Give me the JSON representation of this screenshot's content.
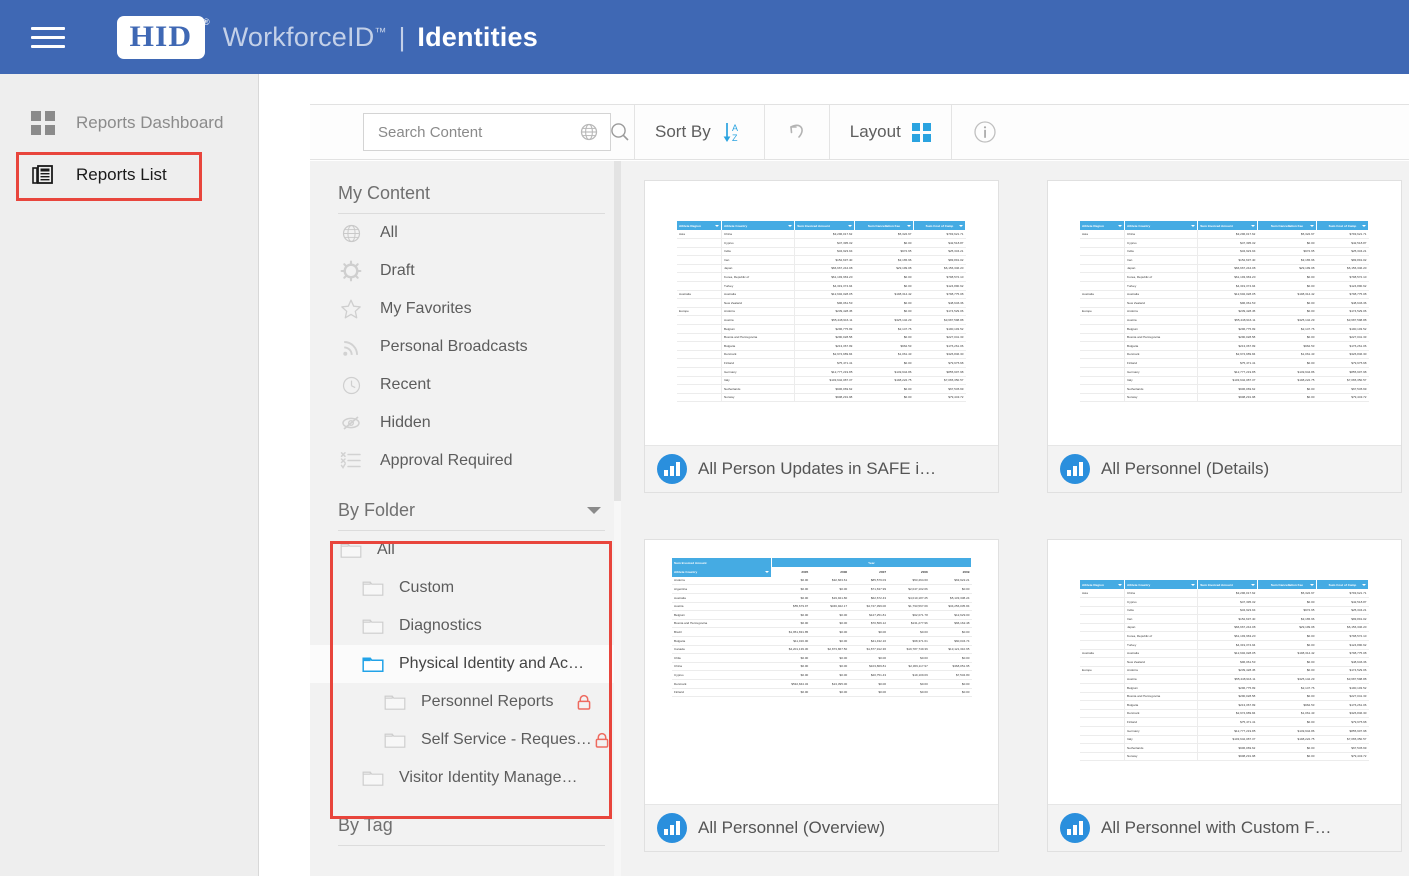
{
  "header": {
    "menu_icon": "hamburger-icon",
    "logo_text": "HID",
    "logo_registered": "®",
    "product_name": "WorkforceID",
    "trademark": "™",
    "separator": "|",
    "section": "Identities",
    "bg_color": "#3f68b4"
  },
  "left_nav": {
    "items": [
      {
        "label": "Reports Dashboard",
        "icon": "dashboard-icon",
        "selected": false
      },
      {
        "label": "Reports List",
        "icon": "reports-list-icon",
        "selected": true
      }
    ]
  },
  "toolbar": {
    "search": {
      "placeholder": "Search Content",
      "value": ""
    },
    "globe_icon": "globe-icon",
    "search_icon": "magnifier-icon",
    "sort_by_label": "Sort By",
    "sort_icon": "sort-az-icon",
    "undo_icon": "undo-icon",
    "layout_label": "Layout",
    "layout_icon": "grid-icon",
    "info_icon": "info-icon",
    "accent_color": "#2aa3e0"
  },
  "filter_panel": {
    "my_content": {
      "title": "My Content",
      "items": [
        {
          "label": "All",
          "icon": "globe-icon"
        },
        {
          "label": "Draft",
          "icon": "gear-icon"
        },
        {
          "label": "My Favorites",
          "icon": "star-icon"
        },
        {
          "label": "Personal Broadcasts",
          "icon": "rss-icon"
        },
        {
          "label": "Recent",
          "icon": "clock-icon"
        },
        {
          "label": "Hidden",
          "icon": "eye-slash-icon"
        },
        {
          "label": "Approval Required",
          "icon": "checklist-icon"
        }
      ]
    },
    "by_folder": {
      "title": "By Folder",
      "collapse_icon": "caret-down-icon",
      "items": [
        {
          "label": "All",
          "indent": 0,
          "selected": false,
          "locked": false
        },
        {
          "label": "Custom",
          "indent": 1,
          "selected": false,
          "locked": false
        },
        {
          "label": "Diagnostics",
          "indent": 1,
          "selected": false,
          "locked": false
        },
        {
          "label": "Physical Identity and Ac…",
          "indent": 1,
          "selected": true,
          "locked": false
        },
        {
          "label": "Personnel Reports",
          "indent": 2,
          "selected": false,
          "locked": true
        },
        {
          "label": "Self Service - Reques…",
          "indent": 2,
          "selected": false,
          "locked": true
        },
        {
          "label": "Visitor Identity Manage…",
          "indent": 1,
          "selected": false,
          "locked": false
        }
      ]
    },
    "by_tag": {
      "title": "By Tag"
    }
  },
  "cards": [
    {
      "title": "All Person Updates in SAFE i…",
      "icon": "bar-chart-icon",
      "thumb": "detail"
    },
    {
      "title": "All Personnel (Details)",
      "icon": "bar-chart-icon",
      "thumb": "detail"
    },
    {
      "title": "All Personnel (Overview)",
      "icon": "bar-chart-icon",
      "thumb": "pivot"
    },
    {
      "title": "All Personnel with Custom F…",
      "icon": "bar-chart-icon",
      "thumb": "detail"
    }
  ],
  "thumbnail_detail": {
    "columns": [
      "Athlete Region",
      "Athlete Country",
      "Sum Invoiced Amount",
      "Sum Cancellation Fee",
      "Sum Cost of Camp"
    ],
    "rows": [
      [
        "Asia",
        "China",
        "$3,296,017.62",
        "$5,322.67",
        "$793,621.71"
      ],
      [
        "",
        "Cyprus",
        "$47,395.32",
        "$0.00",
        "$42,518.87"
      ],
      [
        "",
        "India",
        "$34,923.94",
        "$972.65",
        "$25,334.21"
      ],
      [
        "",
        "Iran",
        "$152,697.40",
        "$3,165.96",
        "$83,891.02"
      ],
      [
        "",
        "Japan",
        "$66,667,244.08",
        "$29,199.08",
        "$6,156,346.20"
      ],
      [
        "",
        "Korea, Republic of",
        "$61,193,963.20",
        "$0.00",
        "$798,572.10"
      ],
      [
        "",
        "Turkey",
        "$4,319,374.94",
        "$0.00",
        "$124,890.62"
      ],
      [
        "Australia",
        "Australia",
        "$12,602,028.05",
        "$198,314.42",
        "$798,775.08"
      ],
      [
        "",
        "New Zealand",
        "$96,061.53",
        "$0.00",
        "$48,646.36"
      ],
      [
        "Europe",
        "Andorra",
        "$239,428.45",
        "$0.00",
        "$174,529.06"
      ],
      [
        "",
        "Austria",
        "$55,448,916.11",
        "$325,142.29",
        "$3,687,598.88"
      ],
      [
        "",
        "Belgium",
        "$296,775.99",
        "$2,147.76",
        "$190,103.52"
      ],
      [
        "",
        "Bosnia and Herzegovina",
        "$290,028.58",
        "$0.00",
        "$227,041.33"
      ],
      [
        "",
        "Bulgaria",
        "$213,367.99",
        "$962.53",
        "$176,261.06"
      ],
      [
        "",
        "Denmark",
        "$2,974,989.84",
        "$1,061.43",
        "$326,846.30"
      ],
      [
        "",
        "Finland",
        "$75,471.41",
        "$0.00",
        "$79,975.68"
      ],
      [
        "",
        "Germany",
        "$12,777,219.85",
        "$149,944.86",
        "$855,907.98"
      ],
      [
        "",
        "Italy",
        "$103,642,087.37",
        "$198,222.75",
        "$7,065,350.57"
      ],
      [
        "",
        "Netherlands",
        "$906,069.62",
        "$0.00",
        "$67,545.69"
      ],
      [
        "",
        "Norway",
        "$908,291.98",
        "$0.00",
        "$79,443.72"
      ]
    ]
  },
  "thumbnail_pivot": {
    "measure_label": "Sum Invoiced Amount",
    "row_label": "Athlete Country",
    "column_group": "Year",
    "years": [
      "2005",
      "2006",
      "2007",
      "2008",
      "2009"
    ],
    "rows": [
      [
        "Andorra",
        "$0.00",
        "$32,663.61",
        "$85,579.03",
        "$53,264.60",
        "$63,922.21"
      ],
      [
        "Argentina",
        "$0.00",
        "$0.00",
        "$71,637.99",
        "$2,047,102.06",
        "$0.00"
      ],
      [
        "Australia",
        "$0.00",
        "$19,921.80",
        "$62,672.43",
        "$4,010,187.25",
        "$5,133,338.24"
      ],
      [
        "Austria",
        "$55,679.97",
        "$346,922.17",
        "$4,727,399.00",
        "$1,793,567.09",
        "$34,256,035.84"
      ],
      [
        "Belgium",
        "$0.00",
        "$0.00",
        "$127,251.81",
        "$62,071.78",
        "$12,629.00"
      ],
      [
        "Bosnia and Herzegovina",
        "$0.00",
        "$0.00",
        "$70,566.12",
        "$131,277.96",
        "$66,162.48"
      ],
      [
        "Brazil",
        "$1,951,831.85",
        "$0.00",
        "$0.00",
        "$0.00",
        "$0.00"
      ],
      [
        "Bulgaria",
        "$11,016.00",
        "$0.00",
        "$41,432.16",
        "$68,371.61",
        "$60,034.74"
      ],
      [
        "Canada",
        "$4,201,139.30",
        "$2,873,867.50",
        "$1,877,912.36",
        "$19,787,749.36",
        "$13,121,310.65"
      ],
      [
        "Chile",
        "$0.00",
        "$0.00",
        "$0.00",
        "$0.00",
        "$0.00"
      ],
      [
        "China",
        "$0.00",
        "$0.00",
        "$103,869.81",
        "$2,369,117.97",
        "$368,051.95"
      ],
      [
        "Cyprus",
        "$0.00",
        "$0.00",
        "$20,751.43",
        "$19,109.09",
        "$7,534.80"
      ],
      [
        "Denmark",
        "$532,844.32",
        "$13,395.00",
        "$0.00",
        "$0.00",
        "$0.00"
      ],
      [
        "Finland",
        "$0.00",
        "$0.00",
        "$0.00",
        "$0.00",
        "$0.00"
      ]
    ]
  },
  "annotations": [
    {
      "name": "reports-list-highlight",
      "color": "#e8453c"
    },
    {
      "name": "by-folder-highlight",
      "color": "#e8453c"
    }
  ]
}
